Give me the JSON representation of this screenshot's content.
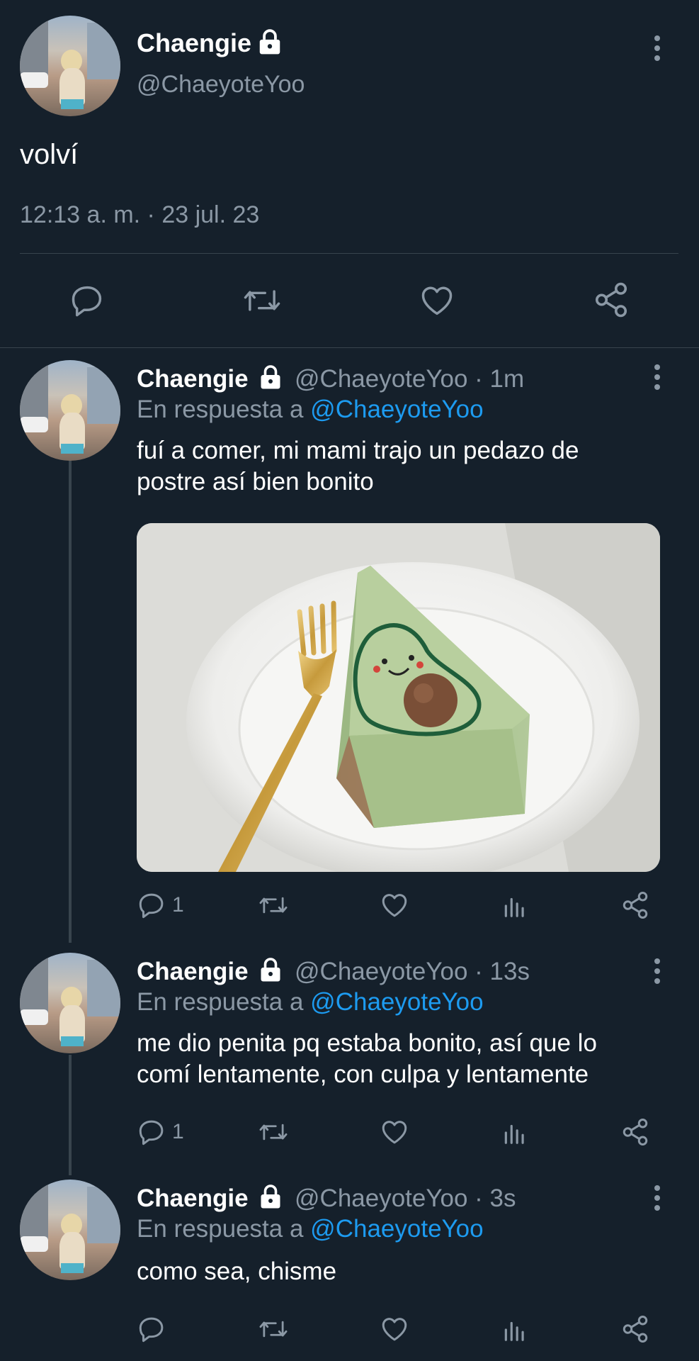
{
  "main_tweet": {
    "display_name": "Chaengie",
    "handle": "@ChaeyoteYoo",
    "text": "volví",
    "timestamp": "12:13 a. m. · 23 jul. 23"
  },
  "replies": [
    {
      "display_name": "Chaengie",
      "handle": "@ChaeyoteYoo",
      "time": "· 1m",
      "reply_prefix": "En respuesta a",
      "reply_to": "@ChaeyoteYoo",
      "text_line1": "fuí a comer, mi mami trajo un pedazo de",
      "text_line2": "postre así bien bonito",
      "reply_count": "1"
    },
    {
      "display_name": "Chaengie",
      "handle": "@ChaeyoteYoo",
      "time": "· 13s",
      "reply_prefix": "En respuesta a",
      "reply_to": "@ChaeyoteYoo",
      "text_line1": "me dio penita pq estaba bonito, así que lo",
      "text_line2": "comí lentamente, con culpa y lentamente",
      "reply_count": "1"
    },
    {
      "display_name": "Chaengie",
      "handle": "@ChaeyoteYoo",
      "time": "· 3s",
      "reply_prefix": "En respuesta a",
      "reply_to": "@ChaeyoteYoo",
      "text_line1": "como sea, chisme",
      "reply_count": ""
    }
  ],
  "icons": [
    "lock-icon",
    "more-icon",
    "reply-icon",
    "retweet-icon",
    "like-icon",
    "share-icon",
    "views-icon"
  ],
  "colors": {
    "background": "#15202b",
    "muted": "#8b98a5",
    "link": "#1d9bf0",
    "divider": "#38444d"
  }
}
